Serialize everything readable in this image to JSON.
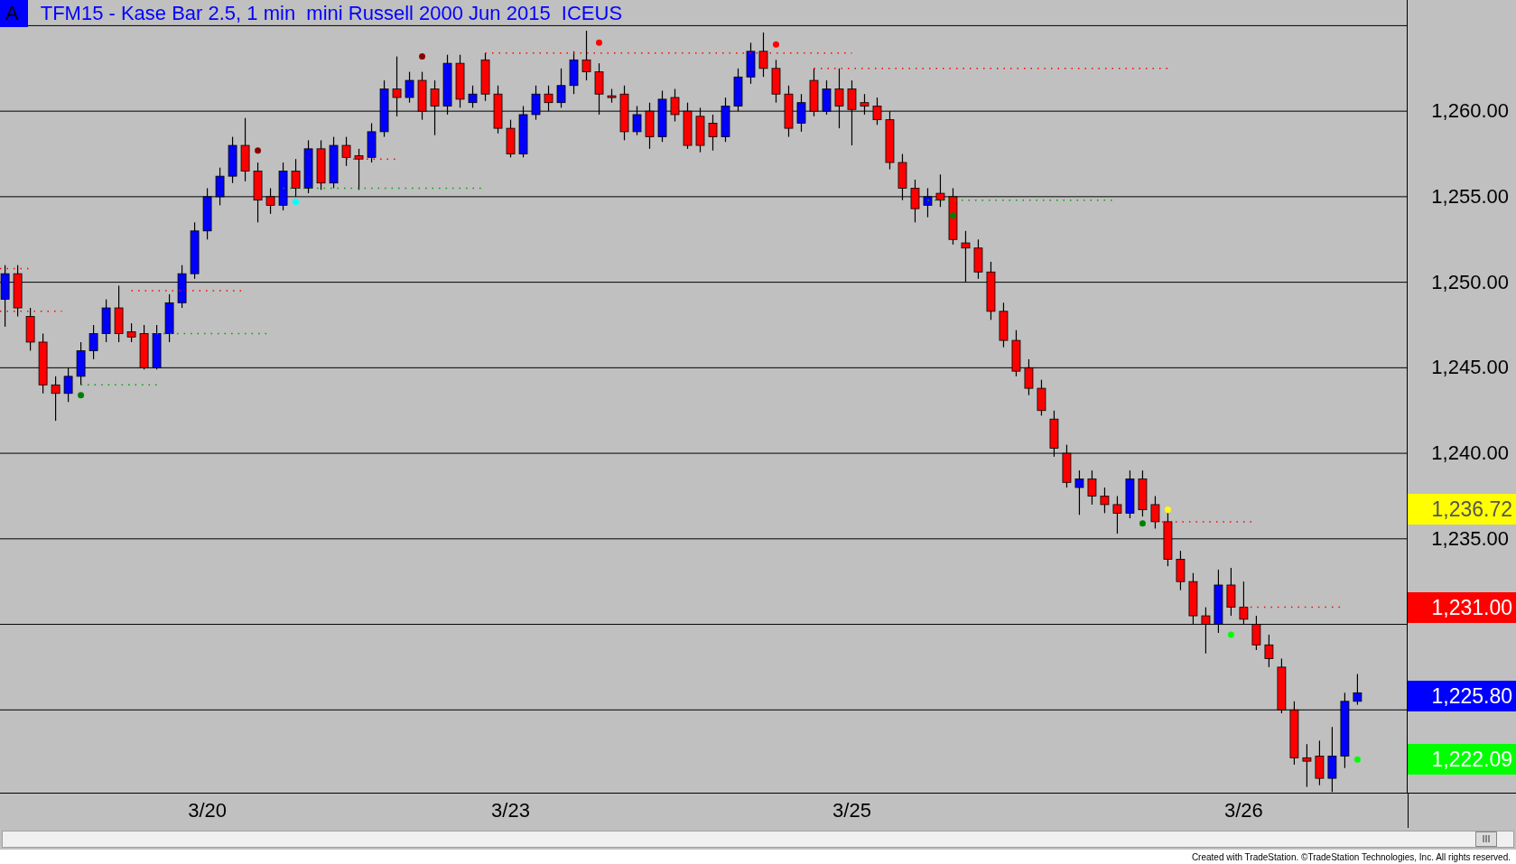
{
  "title_badge": "A",
  "title": "TFM15 - Kase Bar 2.5, 1 min  mini Russell 2000 Jun 2015  ICEUS",
  "chart_data": {
    "type": "candlestick",
    "grid": true,
    "ylim": [
      1220.16,
      1266.5
    ],
    "yticks": [
      {
        "value": 1260,
        "label": "1,260.00"
      },
      {
        "value": 1255,
        "label": "1,255.00"
      },
      {
        "value": 1250,
        "label": "1,250.00"
      },
      {
        "value": 1245,
        "label": "1,245.00"
      },
      {
        "value": 1240,
        "label": "1,240.00"
      },
      {
        "value": 1235,
        "label": "1,235.00"
      }
    ],
    "categories": [
      null,
      null,
      null,
      null,
      null,
      null,
      null,
      null,
      null,
      null,
      null,
      null,
      null,
      null,
      null,
      null,
      "3/20",
      null,
      null,
      null,
      null,
      null,
      null,
      null,
      null,
      null,
      null,
      null,
      null,
      null,
      null,
      null,
      null,
      null,
      null,
      null,
      null,
      null,
      null,
      null,
      "3/23",
      null,
      null,
      null,
      null,
      null,
      null,
      null,
      null,
      null,
      null,
      null,
      null,
      null,
      null,
      null,
      null,
      null,
      null,
      null,
      null,
      null,
      null,
      null,
      null,
      null,
      null,
      "3/25",
      null,
      null,
      null,
      null,
      null,
      null,
      null,
      null,
      null,
      null,
      null,
      null,
      null,
      null,
      null,
      null,
      null,
      null,
      null,
      null,
      null,
      null,
      null,
      null,
      null,
      null,
      null,
      null,
      null,
      null,
      "3/26",
      null,
      null,
      null,
      null,
      null,
      null,
      null,
      null,
      null
    ],
    "ohlc": [
      [
        1249,
        1251,
        1247.4,
        1250.5
      ],
      [
        1250.5,
        1251,
        1248,
        1248.5
      ],
      [
        1248,
        1248.5,
        1246,
        1246.5
      ],
      [
        1246.5,
        1247,
        1243.5,
        1244
      ],
      [
        1244,
        1244.5,
        1241.9,
        1243.5
      ],
      [
        1243.5,
        1245,
        1243,
        1244.5
      ],
      [
        1244.5,
        1246.5,
        1244,
        1246
      ],
      [
        1246,
        1247.5,
        1245.5,
        1247
      ],
      [
        1247,
        1249,
        1246.5,
        1248.5
      ],
      [
        1248.5,
        1249.8,
        1246.5,
        1247
      ],
      [
        1247.1,
        1247.6,
        1246.5,
        1246.8
      ],
      [
        1247,
        1247.5,
        1244.9,
        1245
      ],
      [
        1245,
        1247.5,
        1244.9,
        1247
      ],
      [
        1247,
        1249.3,
        1246.5,
        1248.8
      ],
      [
        1248.8,
        1251,
        1248.5,
        1250.5
      ],
      [
        1250.5,
        1253.5,
        1250.2,
        1253
      ],
      [
        1253,
        1255.5,
        1252.5,
        1255
      ],
      [
        1255,
        1256.7,
        1254.5,
        1256.2
      ],
      [
        1256.2,
        1258.5,
        1255.8,
        1258
      ],
      [
        1258,
        1259.6,
        1255.9,
        1256.5
      ],
      [
        1256.5,
        1257,
        1253.5,
        1254.8
      ],
      [
        1255,
        1255.5,
        1254,
        1254.5
      ],
      [
        1254.5,
        1257,
        1254.2,
        1256.5
      ],
      [
        1256.5,
        1257.2,
        1255,
        1255.5
      ],
      [
        1255.5,
        1258.3,
        1255.2,
        1257.8
      ],
      [
        1257.8,
        1258.3,
        1255.4,
        1255.8
      ],
      [
        1255.8,
        1258.5,
        1255.5,
        1258
      ],
      [
        1258,
        1258.5,
        1256.8,
        1257.3
      ],
      [
        1257.4,
        1257.8,
        1255.4,
        1257.2
      ],
      [
        1257.3,
        1259.3,
        1257,
        1258.8
      ],
      [
        1258.8,
        1261.8,
        1258.5,
        1261.3
      ],
      [
        1261.3,
        1263.2,
        1259.7,
        1260.8
      ],
      [
        1260.8,
        1262.3,
        1260.5,
        1261.8
      ],
      [
        1261.8,
        1262.3,
        1259.5,
        1260
      ],
      [
        1261.3,
        1261.8,
        1258.6,
        1260.3
      ],
      [
        1260.3,
        1263.3,
        1259.8,
        1262.8
      ],
      [
        1262.8,
        1263.3,
        1260.2,
        1260.7
      ],
      [
        1260.5,
        1261.5,
        1260.2,
        1261
      ],
      [
        1263,
        1263.4,
        1260.6,
        1261
      ],
      [
        1261,
        1261.5,
        1258.7,
        1259
      ],
      [
        1259,
        1259.5,
        1257.3,
        1257.5
      ],
      [
        1257.5,
        1260.3,
        1257.3,
        1259.8
      ],
      [
        1259.8,
        1261.5,
        1259.5,
        1261
      ],
      [
        1261,
        1261.5,
        1260,
        1260.5
      ],
      [
        1260.5,
        1262.5,
        1260.2,
        1261.5
      ],
      [
        1261.5,
        1263.5,
        1261,
        1263
      ],
      [
        1263,
        1264.7,
        1261.8,
        1262.3
      ],
      [
        1262.3,
        1262.8,
        1259.8,
        1261
      ],
      [
        1260.9,
        1261.3,
        1260.5,
        1260.8
      ],
      [
        1261,
        1261.5,
        1258.3,
        1258.8
      ],
      [
        1258.8,
        1260.3,
        1258.6,
        1259.8
      ],
      [
        1260,
        1260.5,
        1257.8,
        1258.5
      ],
      [
        1258.5,
        1261.2,
        1258.2,
        1260.7
      ],
      [
        1260.8,
        1261.3,
        1259.4,
        1259.8
      ],
      [
        1260,
        1260.5,
        1257.8,
        1258
      ],
      [
        1259.7,
        1260.2,
        1257.6,
        1258
      ],
      [
        1259.3,
        1259.8,
        1257.7,
        1258.5
      ],
      [
        1258.5,
        1260.8,
        1258.2,
        1260.3
      ],
      [
        1260.3,
        1262.5,
        1260,
        1262
      ],
      [
        1262,
        1264,
        1261.6,
        1263.5
      ],
      [
        1263.5,
        1264.6,
        1262,
        1262.5
      ],
      [
        1262.5,
        1263,
        1260.5,
        1261
      ],
      [
        1261,
        1261.5,
        1258.5,
        1259
      ],
      [
        1259.3,
        1261,
        1258.8,
        1260.5
      ],
      [
        1261.8,
        1262.5,
        1259.7,
        1260
      ],
      [
        1260,
        1261.8,
        1259.8,
        1261.3
      ],
      [
        1261.3,
        1262.5,
        1259,
        1260.3
      ],
      [
        1261.3,
        1261.8,
        1258,
        1260.1
      ],
      [
        1260.5,
        1261,
        1259.8,
        1260.3
      ],
      [
        1260.3,
        1260.8,
        1259.2,
        1259.5
      ],
      [
        1259.5,
        1260,
        1256.6,
        1257
      ],
      [
        1257,
        1257.5,
        1254.8,
        1255.5
      ],
      [
        1255.5,
        1256,
        1253.5,
        1254.3
      ],
      [
        1254.5,
        1255.5,
        1253.8,
        1255
      ],
      [
        1255.2,
        1256.3,
        1254.4,
        1254.8
      ],
      [
        1255,
        1255.5,
        1252.2,
        1252.5
      ],
      [
        1252.3,
        1253,
        1250,
        1252
      ],
      [
        1252,
        1252.5,
        1250.2,
        1250.6
      ],
      [
        1250.6,
        1251.2,
        1247.8,
        1248.3
      ],
      [
        1248.3,
        1248.8,
        1246.2,
        1246.6
      ],
      [
        1246.6,
        1247.2,
        1244.5,
        1244.8
      ],
      [
        1245,
        1245.5,
        1243.4,
        1243.8
      ],
      [
        1243.8,
        1244.3,
        1242.2,
        1242.5
      ],
      [
        1242,
        1242.5,
        1239.8,
        1240.3
      ],
      [
        1240,
        1240.5,
        1238,
        1238.3
      ],
      [
        1238,
        1239,
        1236.4,
        1238.5
      ],
      [
        1238.5,
        1239,
        1237,
        1237.5
      ],
      [
        1237.5,
        1238,
        1236.5,
        1237
      ],
      [
        1237,
        1237.5,
        1235.3,
        1236.5
      ],
      [
        1236.5,
        1239,
        1236.2,
        1238.5
      ],
      [
        1238.5,
        1239,
        1236.3,
        1236.7
      ],
      [
        1237,
        1237.5,
        1235.6,
        1236
      ],
      [
        1236,
        1236.5,
        1233.4,
        1233.8
      ],
      [
        1233.8,
        1234.3,
        1232,
        1232.5
      ],
      [
        1232.5,
        1233,
        1230,
        1230.5
      ],
      [
        1230.5,
        1231,
        1228.3,
        1230
      ],
      [
        1230,
        1233.2,
        1229.5,
        1232.3
      ],
      [
        1232.3,
        1233.3,
        1230.5,
        1231
      ],
      [
        1231,
        1232.5,
        1230,
        1230.3
      ],
      [
        1230,
        1230.5,
        1228.5,
        1228.8
      ],
      [
        1228.8,
        1229.4,
        1227.5,
        1228
      ],
      [
        1227.5,
        1228,
        1224.8,
        1225
      ],
      [
        1225,
        1225.5,
        1221.8,
        1222.2
      ],
      [
        1222.2,
        1223,
        1220.5,
        1222
      ],
      [
        1222.3,
        1223.2,
        1220.6,
        1221
      ],
      [
        1221,
        1224,
        1220.2,
        1222.3
      ],
      [
        1222.3,
        1226,
        1221.6,
        1225.5
      ],
      [
        1225.5,
        1227.1,
        1225.3,
        1226
      ]
    ]
  },
  "price_markers": [
    {
      "label": "1,236.72",
      "color": "#ffff00"
    },
    {
      "label": "1,231.00",
      "color": "#ff0000"
    },
    {
      "label": "1,225.80",
      "color": "#0000ff"
    },
    {
      "label": "1,222.09",
      "color": "#00ff00"
    }
  ],
  "footer": "Created with TradeStation. ©TradeStation Technologies, Inc. All rights reserved."
}
